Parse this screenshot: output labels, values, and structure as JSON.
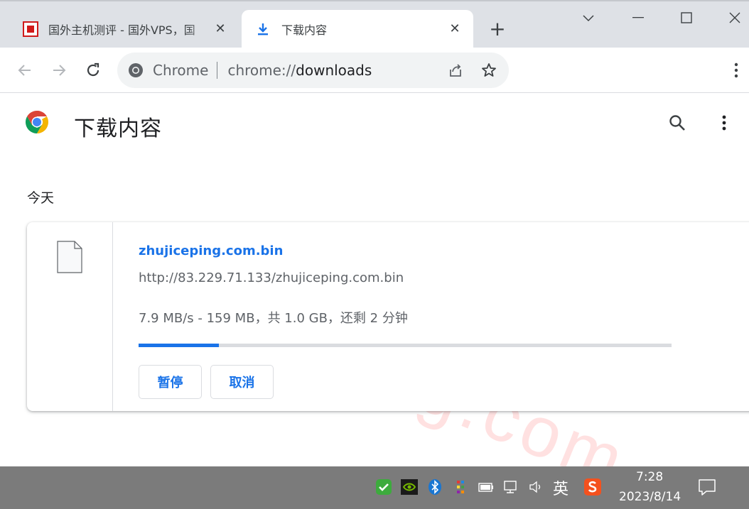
{
  "browser": {
    "tabs": [
      {
        "title": "国外主机测评 - 国外VPS，国",
        "active": false,
        "icon": "site-favicon"
      },
      {
        "title": "下载内容",
        "active": true,
        "icon": "download-icon"
      }
    ],
    "close_glyph": "✕",
    "new_tab_glyph": "+",
    "omnibox": {
      "site_label": "Chrome",
      "url_scheme": "chrome://",
      "url_path": "downloads"
    }
  },
  "page": {
    "title": "下载内容",
    "date_group": "今天",
    "watermark": "zhujiceping.com",
    "download": {
      "file_name": "zhujiceping.com.bin",
      "url": "http://83.229.71.133/zhujiceping.com.bin",
      "status": "7.9 MB/s - 159 MB，共 1.0 GB，还剩 2 分钟",
      "progress_fraction": 0.15,
      "pause_label": "暂停",
      "cancel_label": "取消"
    }
  },
  "taskbar": {
    "ime_label": "英",
    "time": "7:28",
    "date": "2023/8/14"
  },
  "colors": {
    "accent": "#1a73e8",
    "tabstrip": "#dee1e6",
    "taskbar": "#7b7b7b"
  }
}
